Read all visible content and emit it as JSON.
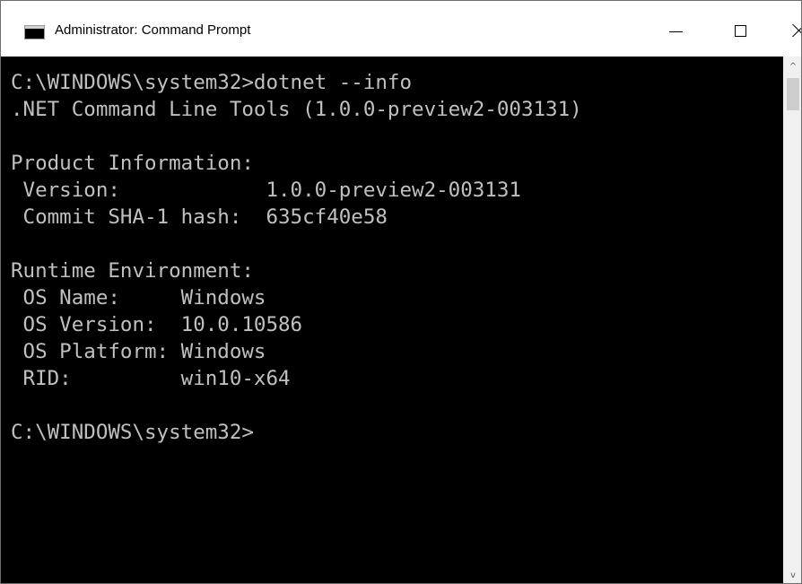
{
  "window": {
    "title": "Administrator: Command Prompt",
    "app_icon": "cmd-icon",
    "app_icon_text": "C:\\"
  },
  "controls": {
    "minimize_icon": "minimize-icon",
    "maximize_icon": "maximize-icon",
    "close_icon": "close-icon"
  },
  "console": {
    "background": "#000000",
    "foreground": "#c0c0c0",
    "lines": [
      "C:\\WINDOWS\\system32>dotnet --info",
      ".NET Command Line Tools (1.0.0-preview2-003131)",
      "",
      "Product Information:",
      " Version:            1.0.0-preview2-003131",
      " Commit SHA-1 hash:  635cf40e58",
      "",
      "Runtime Environment:",
      " OS Name:     Windows",
      " OS Version:  10.0.10586",
      " OS Platform: Windows",
      " RID:         win10-x64",
      "",
      "C:\\WINDOWS\\system32>"
    ]
  },
  "scrollbar": {
    "up_icon": "scroll-up-arrow-icon",
    "down_icon": "scroll-down-arrow-icon",
    "up_glyph": "^",
    "down_glyph": "v"
  }
}
